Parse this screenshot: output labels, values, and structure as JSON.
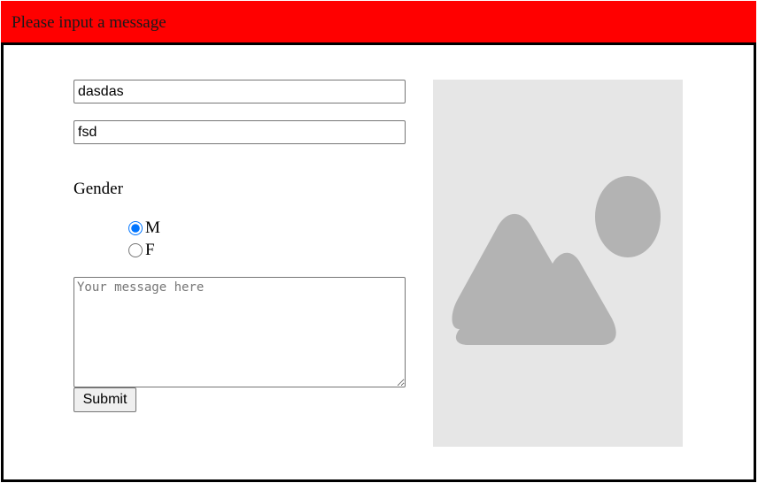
{
  "banner": {
    "title": "Please input a message"
  },
  "form": {
    "first_field": {
      "value": "dasdas"
    },
    "second_field": {
      "value": "fsd"
    },
    "gender": {
      "label": "Gender",
      "options": [
        {
          "label": "M",
          "checked": true
        },
        {
          "label": "F",
          "checked": false
        }
      ]
    },
    "message": {
      "placeholder": "Your message here",
      "value": ""
    },
    "submit_label": "Submit"
  },
  "image": {
    "icon": "image-placeholder-icon"
  },
  "colors": {
    "banner": "#ff0000",
    "frame_border": "#000000",
    "placeholder_bg": "#e6e6e6",
    "placeholder_shape": "#b3b3b3",
    "radio_accent": "#0075ff"
  }
}
